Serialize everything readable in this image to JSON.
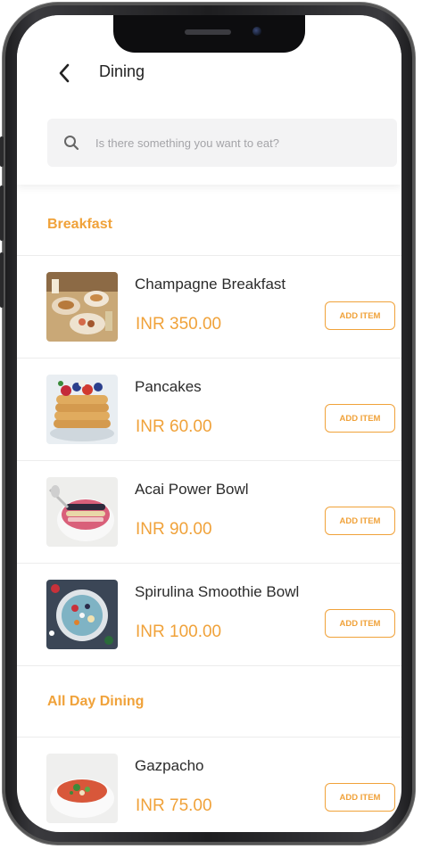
{
  "header": {
    "title": "Dining",
    "back_icon": "chevron-left-icon"
  },
  "search": {
    "placeholder": "Is there something you want to eat?",
    "value": "",
    "icon": "search-icon"
  },
  "sections": [
    {
      "title": "Breakfast",
      "items": [
        {
          "name": "Champagne Breakfast",
          "price": "INR 350.00",
          "button": "ADD ITEM",
          "image": "champagne-breakfast-photo"
        },
        {
          "name": "Pancakes",
          "price": "INR 60.00",
          "button": "ADD ITEM",
          "image": "pancakes-photo"
        },
        {
          "name": "Acai Power Bowl",
          "price": "INR 90.00",
          "button": "ADD ITEM",
          "image": "acai-bowl-photo"
        },
        {
          "name": "Spirulina Smoothie Bowl",
          "price": "INR 100.00",
          "button": "ADD ITEM",
          "image": "smoothie-bowl-photo"
        }
      ]
    },
    {
      "title": "All Day Dining",
      "items": [
        {
          "name": "Gazpacho",
          "price": "INR 75.00",
          "button": "ADD ITEM",
          "image": "gazpacho-photo"
        }
      ]
    }
  ],
  "colors": {
    "accent": "#f0a23a",
    "text": "#2b2b2b",
    "divider": "#ececec",
    "search_bg": "#f3f3f4"
  }
}
